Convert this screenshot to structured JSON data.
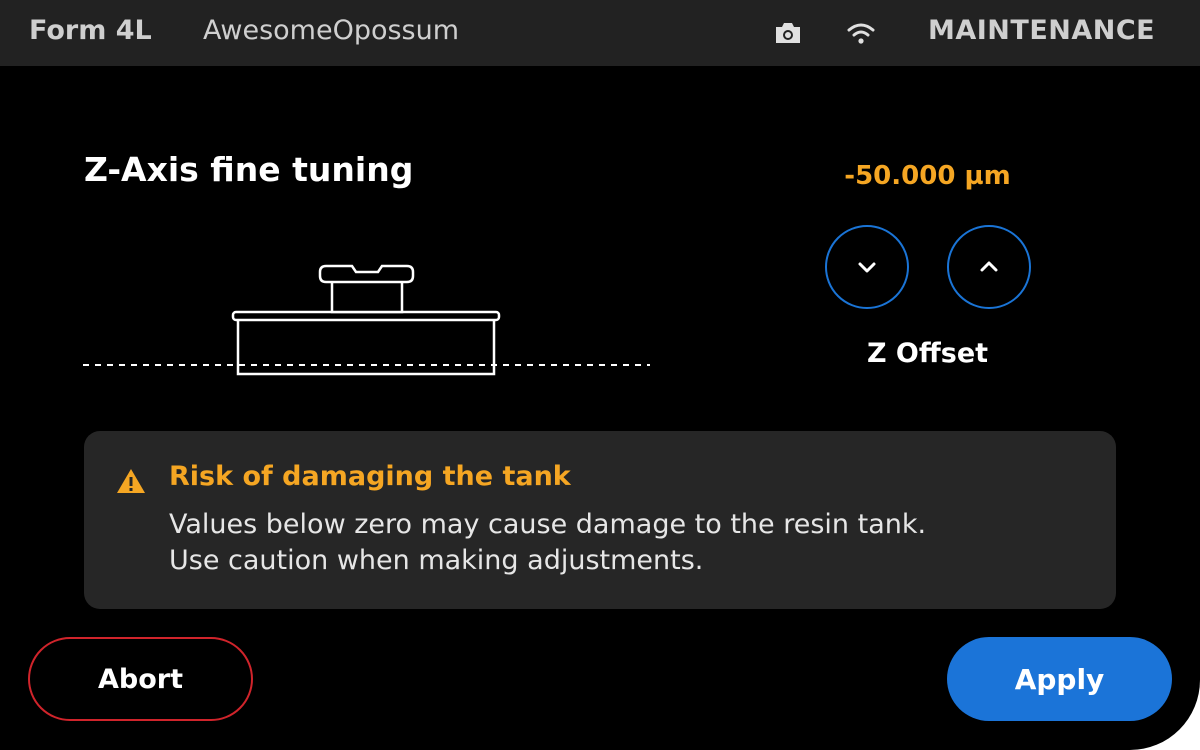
{
  "topbar": {
    "model": "Form 4L",
    "printer_name": "AwesomeOpossum",
    "icons": [
      "camera-icon",
      "wifi-icon"
    ],
    "mode": "MAINTENANCE"
  },
  "main": {
    "title": "Z-Axis fine tuning",
    "offset_value": "-50.000 µm",
    "offset_label": "Z Offset",
    "buttons": {
      "down_icon": "chevron-down-icon",
      "up_icon": "chevron-up-icon"
    }
  },
  "warning": {
    "icon": "warning-triangle-icon",
    "title": "Risk of damaging the tank",
    "line1": "Values below zero may cause damage to the resin tank.",
    "line2": "Use caution when making adjustments."
  },
  "footer": {
    "abort_label": "Abort",
    "apply_label": "Apply"
  },
  "colors": {
    "accent_orange": "#f5a623",
    "primary_blue": "#1b74d8",
    "abort_red": "#d0242b",
    "background": "#000000",
    "topbar": "#222222",
    "panel": "#262626"
  }
}
